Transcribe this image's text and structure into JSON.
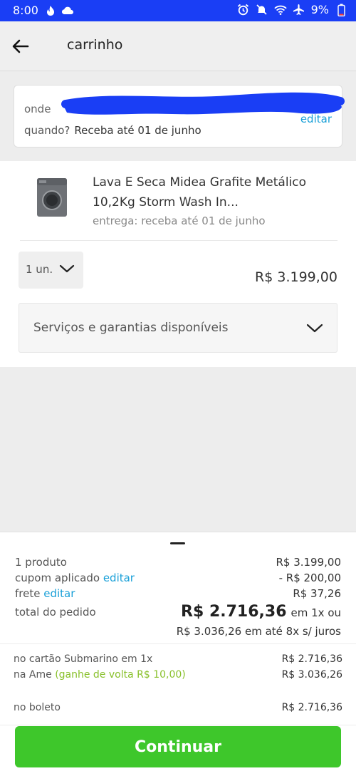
{
  "status_bar": {
    "time": "8:00",
    "battery": "9%",
    "icons_left": [
      "flame-icon",
      "cloud-icon"
    ],
    "icons_right": [
      "alarm-icon",
      "mute-icon",
      "wifi-icon",
      "airplane-icon",
      "battery-icon"
    ]
  },
  "header": {
    "title": "carrinho"
  },
  "address": {
    "onde_label": "onde",
    "edit_label": "editar",
    "when_label": "quando?",
    "when_value": "Receba até 01 de junho"
  },
  "product": {
    "name": "Lava E Seca Midea Grafite Metálico 10,2Kg Storm Wash In...",
    "delivery": "entrega: receba até 01 de junho",
    "quantity": "1 un.",
    "price": "R$ 3.199,00",
    "services_label": "Serviços e garantias disponíveis"
  },
  "summary": {
    "products_label": "1 produto",
    "products_value": "R$ 3.199,00",
    "coupon_label": "cupom aplicado",
    "coupon_edit": "editar",
    "coupon_value": "- R$ 200,00",
    "shipping_label": "frete",
    "shipping_edit": "editar",
    "shipping_value": "R$ 37,26",
    "total_label": "total do pedido",
    "total_value": "R$ 2.716,36",
    "total_suffix": "em 1x ou",
    "installments": "R$ 3.036,26 em até 8x s/ juros",
    "payments": [
      {
        "label": "no cartão Submarino em 1x",
        "extra": "",
        "value": "R$ 2.716,36"
      },
      {
        "label": "na Ame",
        "extra": "(ganhe de volta R$ 10,00)",
        "value": "R$ 3.036,26"
      },
      {
        "label": "no boleto",
        "extra": "",
        "value": "R$ 2.716,36"
      }
    ],
    "continue_label": "Continuar"
  },
  "colors": {
    "status_bar": "#1a3ef5",
    "link": "#1aa0d8",
    "discount": "#88c02a",
    "continue_button": "#3ec72b"
  }
}
